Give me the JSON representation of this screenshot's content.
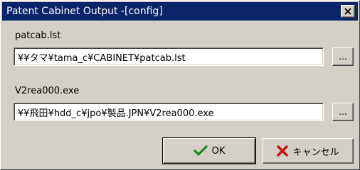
{
  "window": {
    "title": "Patent Cabinet Output -[config]"
  },
  "fields": [
    {
      "label": "patcab.lst",
      "value": "¥¥タマ¥tama_c¥CABINET¥patcab.lst",
      "browse_label": "..."
    },
    {
      "label": "V2rea000.exe",
      "value": "¥¥飛田¥hdd_c¥jpo¥製品.JPN¥V2rea000.exe",
      "browse_label": "..."
    }
  ],
  "buttons": {
    "ok_label": "OK",
    "cancel_label": "キャンセル"
  },
  "icons": {
    "close": "close-icon",
    "ok": "checkmark-icon",
    "cancel": "red-x-icon"
  },
  "colors": {
    "titlebar": "#0a246a",
    "face": "#d4d0c8",
    "checkmark": "#1a8a1a",
    "cancel_x": "#cc1010"
  }
}
